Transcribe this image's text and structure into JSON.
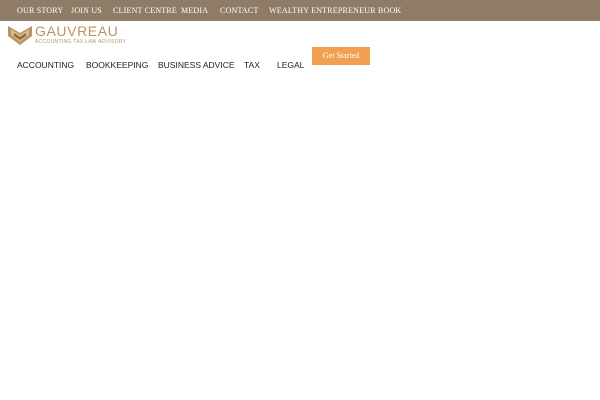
{
  "top_nav": {
    "items": [
      {
        "label": "OUR STORY"
      },
      {
        "label": "JOIN US"
      },
      {
        "label": "CLIENT CENTRE"
      },
      {
        "label": "MEDIA"
      },
      {
        "label": "CONTACT"
      },
      {
        "label": "WEALTHY ENTREPRENEUR BOOK"
      }
    ]
  },
  "logo": {
    "name": "GAUVREAU",
    "tagline": "ACCOUNTING TAX LAW ADVISORY",
    "icon": "gauvreau-logo-icon"
  },
  "main_nav": {
    "items": [
      {
        "label": "ACCOUNTING"
      },
      {
        "label": "BOOKKEEPING"
      },
      {
        "label": "BUSINESS ADVICE"
      },
      {
        "label": "TAX"
      },
      {
        "label": "LEGAL"
      }
    ],
    "cta_label": "Get Started"
  },
  "colors": {
    "topbar": "#8f7c66",
    "brand_gold": "#b89462",
    "cta": "#f0a050"
  }
}
